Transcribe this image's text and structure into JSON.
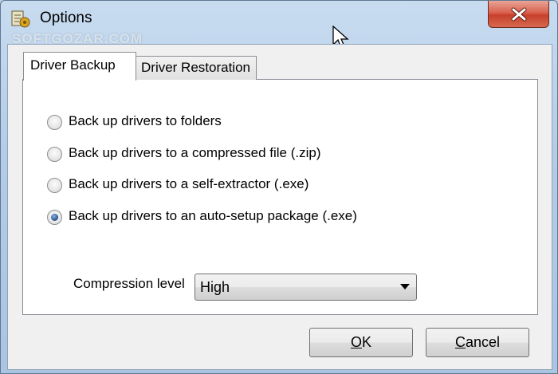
{
  "window": {
    "title": "Options",
    "watermark": "SOFTGOZAR.COM",
    "icon": "driver-tool-icon",
    "close_icon": "close-icon"
  },
  "tabs": [
    {
      "label": "Driver Backup",
      "active": true
    },
    {
      "label": "Driver Restoration",
      "active": false
    }
  ],
  "backup_options": [
    {
      "label": "Back up drivers to folders",
      "checked": false
    },
    {
      "label": "Back up drivers to a compressed file (.zip)",
      "checked": false
    },
    {
      "label": "Back up drivers to a self-extractor (.exe)",
      "checked": false
    },
    {
      "label": "Back up drivers to an auto-setup package (.exe)",
      "checked": true
    }
  ],
  "compression": {
    "label": "Compression level",
    "value": "High"
  },
  "buttons": {
    "ok": {
      "mnemonic": "O",
      "rest": "K"
    },
    "cancel": {
      "mnemonic": "C",
      "rest": "ancel"
    }
  },
  "colors": {
    "close_button": "#d9624f",
    "radio_selected": "#2a5d97"
  }
}
